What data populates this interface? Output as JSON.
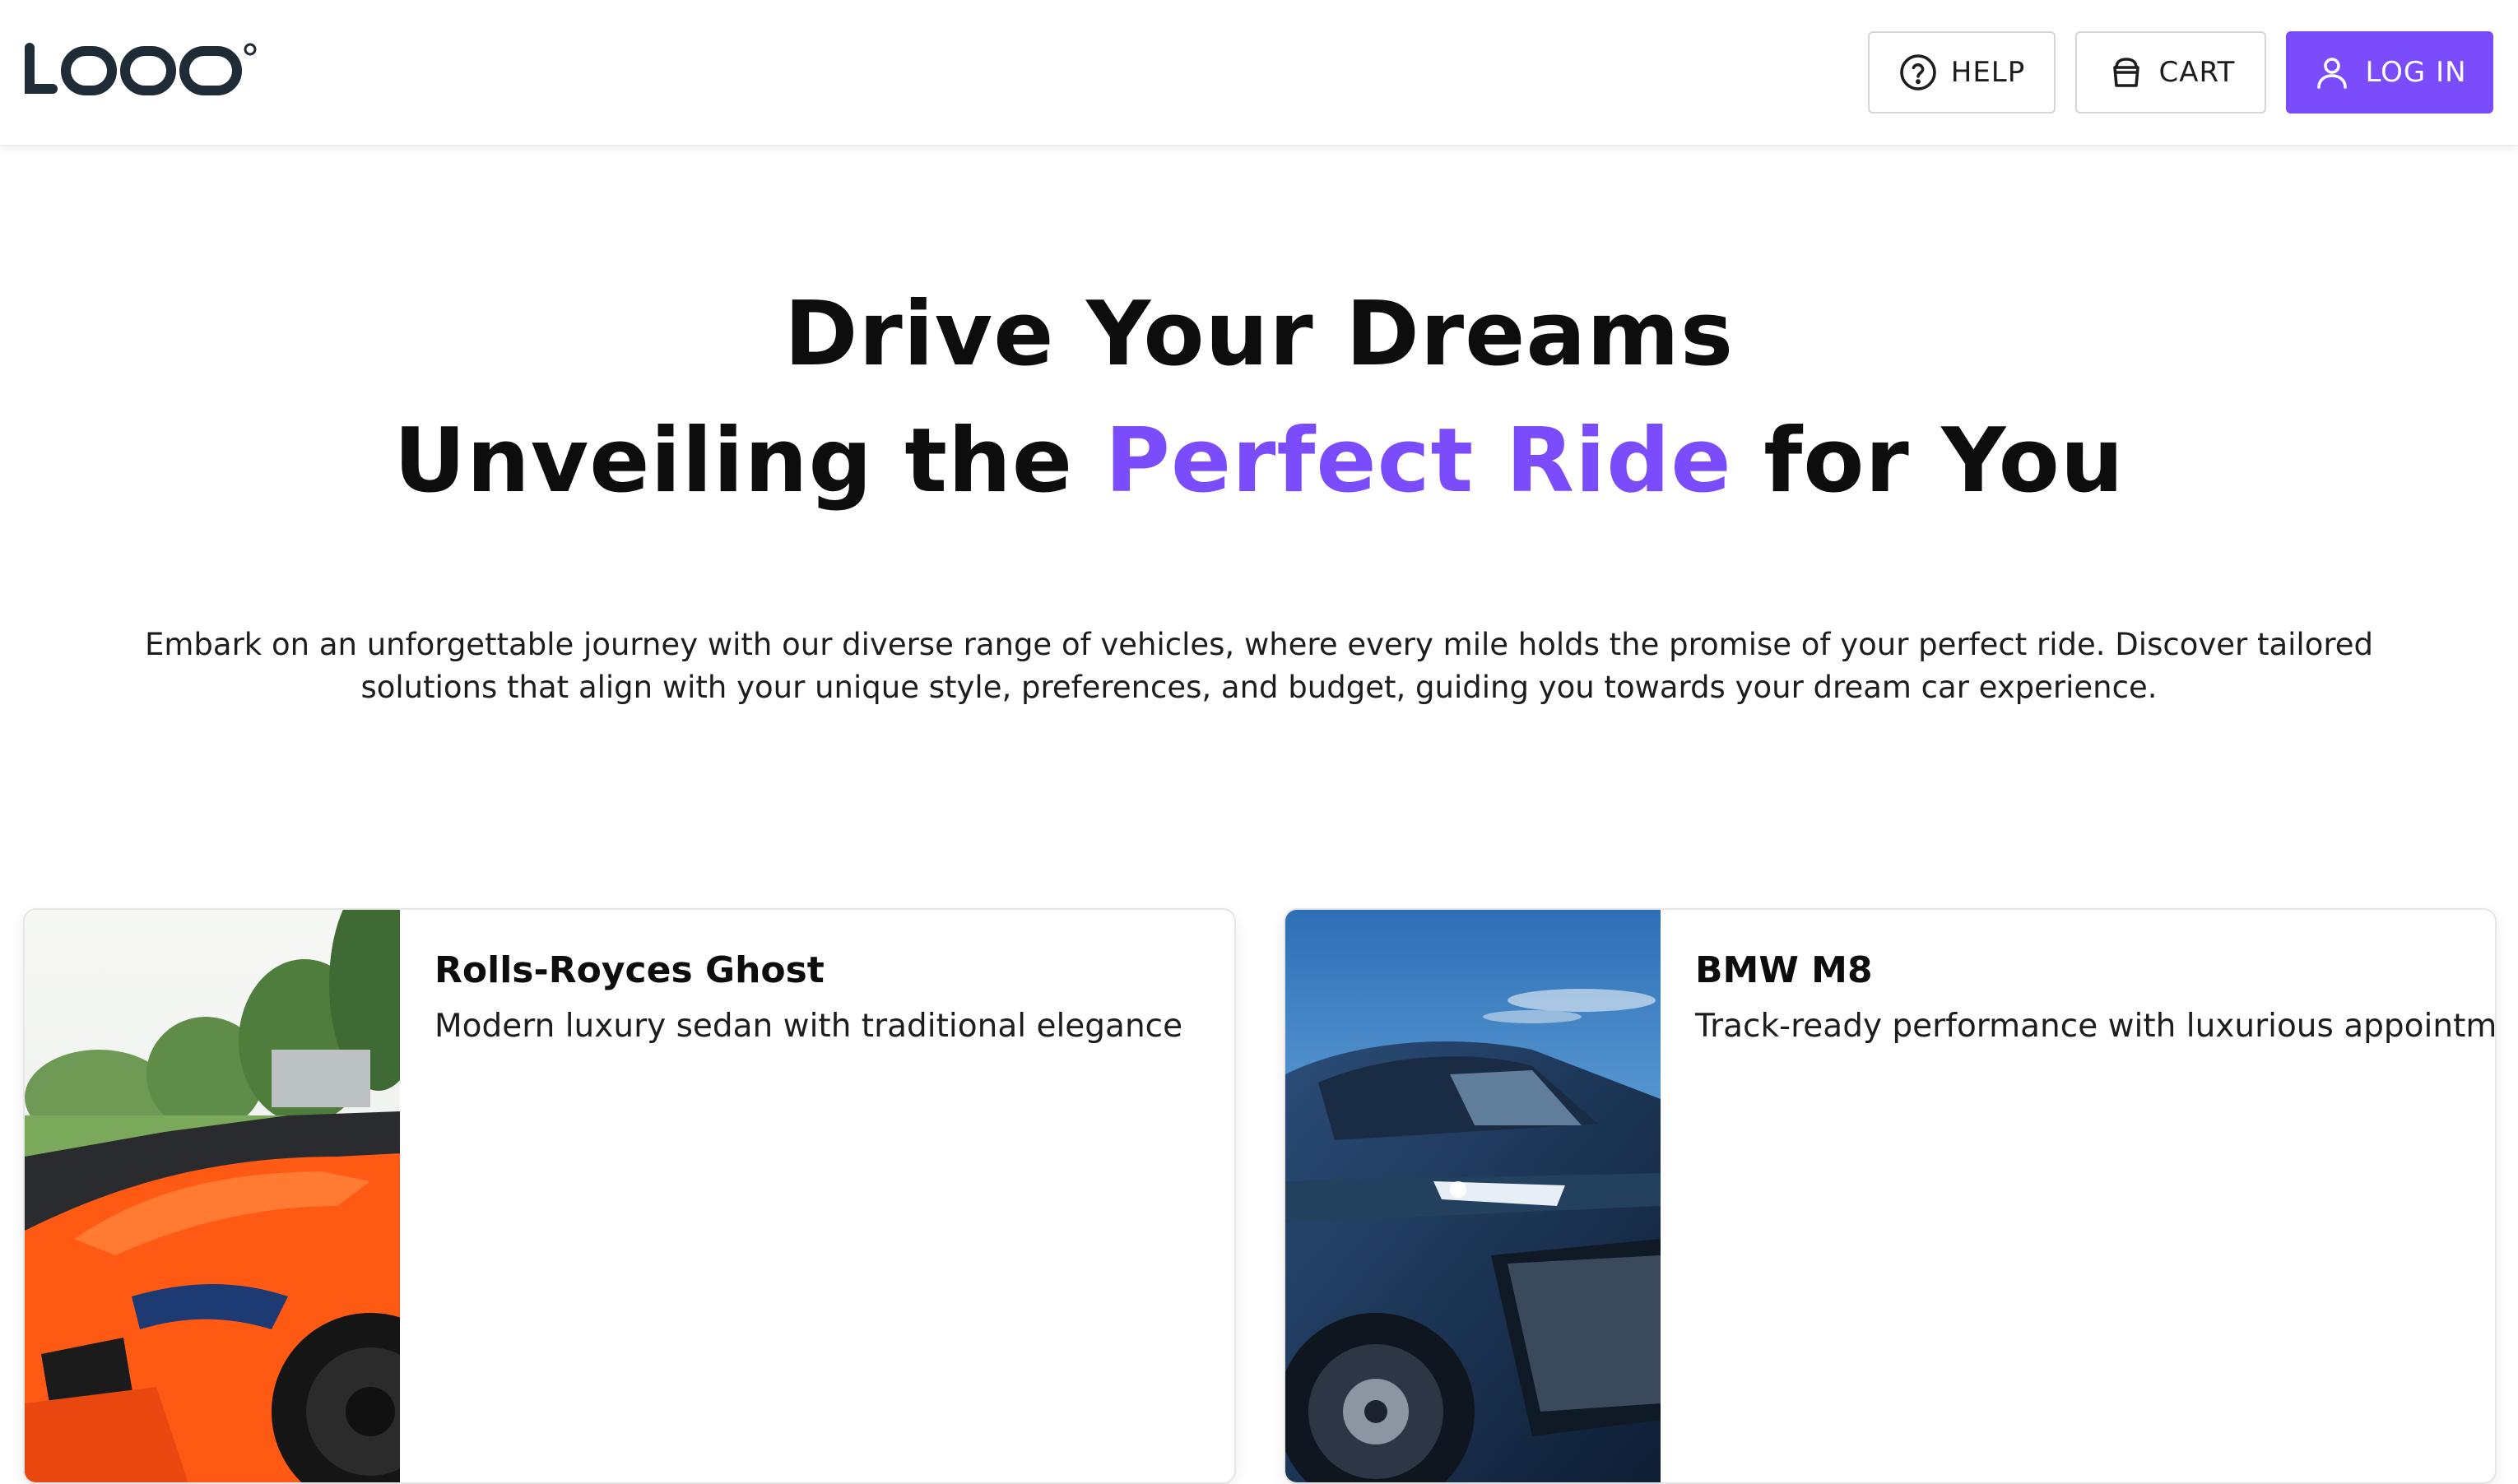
{
  "header": {
    "logo_text": "LOQO",
    "help_label": "HELP",
    "cart_label": "CART",
    "login_label": "LOG IN",
    "icons": {
      "help": "question-circle-icon",
      "cart": "shopping-bag-icon",
      "login": "user-icon"
    }
  },
  "hero": {
    "title_line1": "Drive Your Dreams",
    "title_line2_prefix": "Unveiling the ",
    "title_line2_accent": "Perfect Ride",
    "title_line2_suffix": " for You",
    "description": "Embark on an unforgettable journey with our diverse range of vehicles, where every mile holds the promise of your perfect ride. Discover tailored solutions that align with your unique style, preferences, and budget, guiding you towards your dream car experience."
  },
  "cars": [
    {
      "name": "Rolls-Royces Ghost",
      "description": "Modern luxury sedan with traditional elegance"
    },
    {
      "name": "BMW M8",
      "description": "Track-ready performance with luxurious appointme"
    }
  ],
  "colors": {
    "accent": "#7b4cfb",
    "text": "#0d0d0d",
    "logo": "#1f2b36"
  }
}
